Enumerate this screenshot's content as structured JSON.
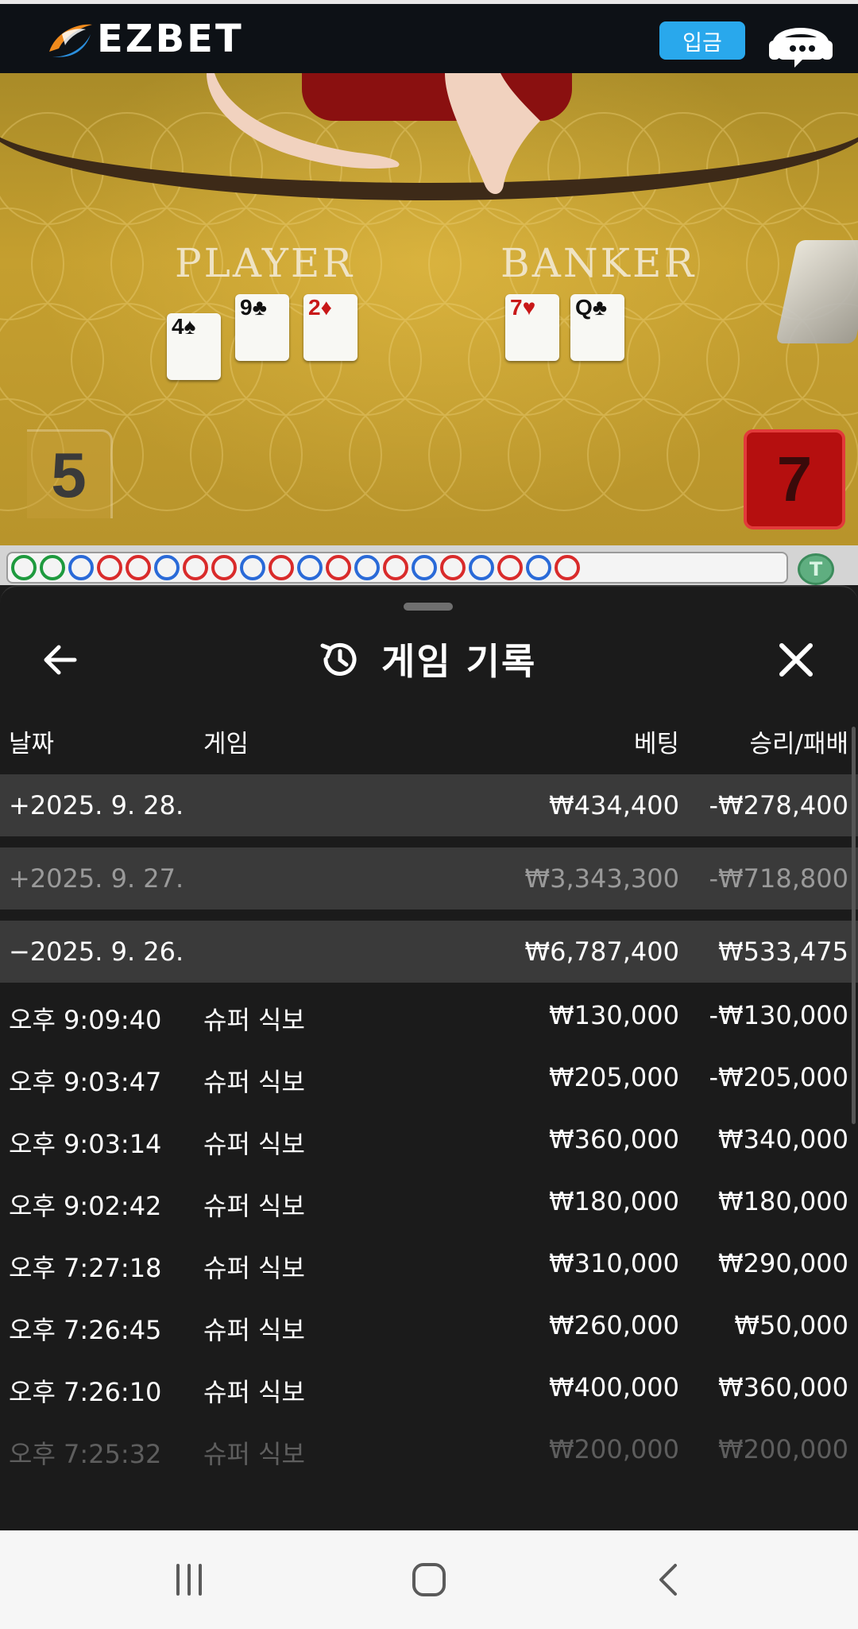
{
  "header": {
    "brand": "EZBET",
    "deposit_label": "입금",
    "icons": {
      "logo": "ezbet-swoosh-logo",
      "support": "headset-chat-icon"
    }
  },
  "game": {
    "player_label": "PLAYER",
    "banker_label": "BANKER",
    "player_score": "5",
    "banker_score": "7",
    "player_cards": [
      {
        "rank": "4",
        "suit": "♠",
        "color": "black"
      },
      {
        "rank": "9",
        "suit": "♣",
        "color": "black"
      },
      {
        "rank": "2",
        "suit": "♦",
        "color": "red"
      }
    ],
    "banker_cards": [
      {
        "rank": "7",
        "suit": "♥",
        "color": "red"
      },
      {
        "rank": "Q",
        "suit": "♣",
        "color": "black"
      }
    ],
    "road_beads": [
      "t",
      "t",
      "b",
      "r",
      "r",
      "b",
      "r",
      "r",
      "b",
      "r",
      "b",
      "r",
      "b",
      "r",
      "b",
      "r",
      "b",
      "r",
      "b",
      "r"
    ],
    "road_tie_label": "T",
    "colors": {
      "player": "#2a6ad8",
      "banker": "#d92b2b",
      "tie": "#1e9a3e"
    }
  },
  "sheet": {
    "title": "게임 기록",
    "icons": {
      "back": "arrow-left-icon",
      "close": "close-icon",
      "title": "history-icon"
    },
    "columns": {
      "date": "날짜",
      "game": "게임",
      "bet": "베팅",
      "result": "승리/패배"
    },
    "days": [
      {
        "date": "+2025. 9. 28.",
        "bet": "₩434,400",
        "result": "-₩278,400"
      },
      {
        "date": "+2025. 9. 27.",
        "bet": "₩3,343,300",
        "result": "-₩718,800"
      },
      {
        "date": "−2025. 9. 26.",
        "bet": "₩6,787,400",
        "result": "₩533,475"
      }
    ],
    "entries": [
      {
        "time": "오후 9:09:40",
        "game": "슈퍼 식보",
        "bet": "₩130,000",
        "result": "-₩130,000"
      },
      {
        "time": "오후 9:03:47",
        "game": "슈퍼 식보",
        "bet": "₩205,000",
        "result": "-₩205,000"
      },
      {
        "time": "오후 9:03:14",
        "game": "슈퍼 식보",
        "bet": "₩360,000",
        "result": "₩340,000"
      },
      {
        "time": "오후 9:02:42",
        "game": "슈퍼 식보",
        "bet": "₩180,000",
        "result": "₩180,000"
      },
      {
        "time": "오후 7:27:18",
        "game": "슈퍼 식보",
        "bet": "₩310,000",
        "result": "₩290,000"
      },
      {
        "time": "오후 7:26:45",
        "game": "슈퍼 식보",
        "bet": "₩260,000",
        "result": "₩50,000"
      },
      {
        "time": "오후 7:26:10",
        "game": "슈퍼 식보",
        "bet": "₩400,000",
        "result": "₩360,000"
      },
      {
        "time": "오후 7:25:32",
        "game": "슈퍼 식보",
        "bet": "₩200,000",
        "result": "₩200,000"
      }
    ]
  },
  "navbar": {
    "icons": {
      "recents": "recent-apps-icon",
      "home": "home-icon",
      "back": "nav-back-icon"
    }
  }
}
